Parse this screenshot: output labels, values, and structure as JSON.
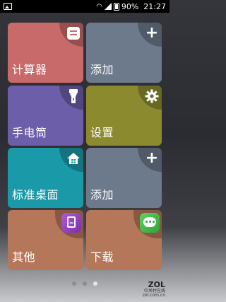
{
  "status_bar": {
    "battery": "90%",
    "time": "21:27"
  },
  "tiles": [
    {
      "label": "计算器",
      "color": "#c96a6a"
    },
    {
      "label": "添加",
      "color": "#6d7a8b"
    },
    {
      "label": "手电筒",
      "color": "#6c5ea8"
    },
    {
      "label": "设置",
      "color": "#8b8a2f"
    },
    {
      "label": "标准桌面",
      "color": "#1a9aa8"
    },
    {
      "label": "添加",
      "color": "#6d7a8b"
    },
    {
      "label": "其他",
      "color": "#b5775a"
    },
    {
      "label": "下载",
      "color": "#b5775a"
    }
  ],
  "icons": {
    "calculator": "minus-in-rounded-square-icon",
    "add": "plus-icon",
    "flashlight": "flashlight-icon",
    "settings": "gear-icon",
    "home": "house-icon",
    "other": "purple-wifi-app-icon",
    "download": "green-chat-app-icon"
  },
  "page_indicator": {
    "count": 3,
    "active": 3
  },
  "watermark": {
    "brand": "ZOL",
    "line1": "中关村在线",
    "line2": "zol.com.cn"
  }
}
